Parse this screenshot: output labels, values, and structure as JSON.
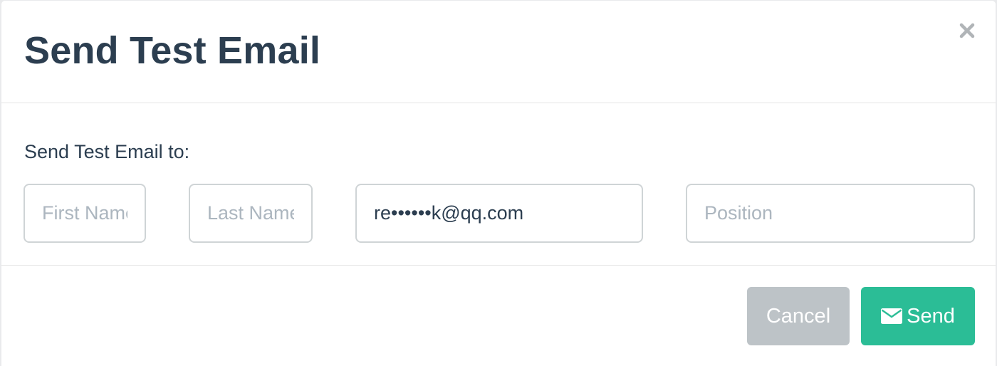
{
  "modal": {
    "title": "Send Test Email",
    "close_symbol": "×",
    "body": {
      "label": "Send Test Email to:",
      "inputs": {
        "first_name": {
          "value": "",
          "placeholder": "First Name"
        },
        "last_name": {
          "value": "",
          "placeholder": "Last Name"
        },
        "email": {
          "value": "re••••••k@qq.com",
          "placeholder": ""
        },
        "position": {
          "value": "",
          "placeholder": "Position"
        }
      }
    },
    "footer": {
      "cancel_label": "Cancel",
      "send_label": "Send",
      "send_icon": "envelope-icon"
    }
  },
  "colors": {
    "title": "#2c3e50",
    "send_button": "#2bbd96",
    "cancel_button": "#bdc3c7",
    "input_border": "#cfd4d6",
    "placeholder": "#acb6bf"
  }
}
